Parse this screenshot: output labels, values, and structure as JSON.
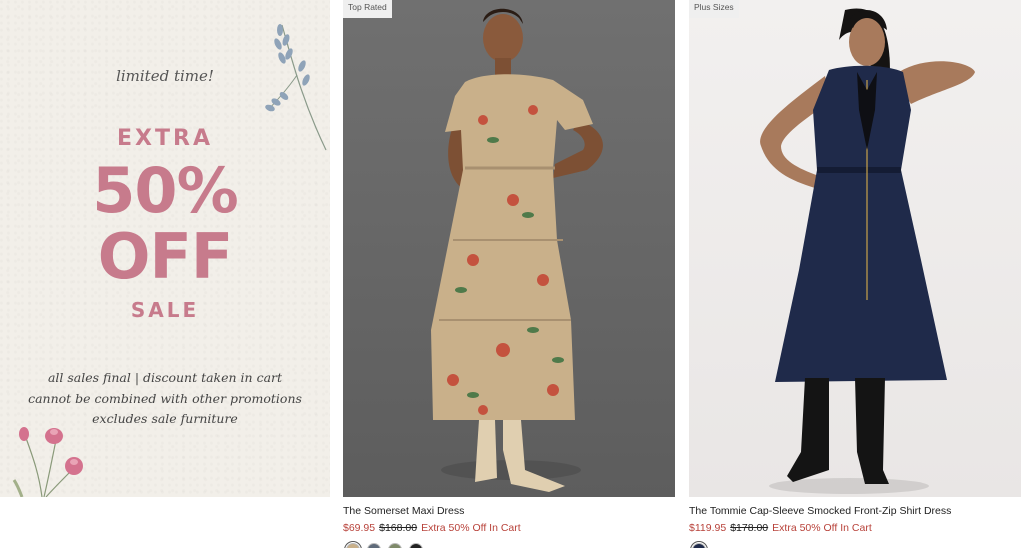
{
  "promo": {
    "eyebrow": "limited time!",
    "extra": "EXTRA",
    "percent": "50%",
    "off": "OFF",
    "sale": "SALE",
    "terms": [
      "all sales final | discount taken in cart",
      "cannot be combined with other promotions",
      "excludes sale furniture"
    ],
    "accent_color": "#c77b8c",
    "decor_icons": [
      "lavender-sprig-icon",
      "pink-flowers-icon"
    ]
  },
  "products": [
    {
      "badge": "Top Rated",
      "title": "The Somerset Maxi Dress",
      "sale_price": "$69.95",
      "original_price": "$168.00",
      "promo_text": "Extra 50% Off In Cart",
      "swatches": [
        "#c9b08a",
        "#5f6b7a",
        "#7f8a6a",
        "#222222"
      ],
      "image_icon": "model-floral-maxi-dress-image"
    },
    {
      "badge": "Plus Sizes",
      "title": "The Tommie Cap-Sleeve Smocked Front-Zip Shirt Dress",
      "sale_price": "$119.95",
      "original_price": "$178.00",
      "promo_text": "Extra 50% Off In Cart",
      "swatches": [
        "#1f2a4a"
      ],
      "image_icon": "model-navy-shirt-dress-image"
    }
  ],
  "colors": {
    "sale_red": "#b8423a",
    "badge_bg": "#efefef"
  }
}
